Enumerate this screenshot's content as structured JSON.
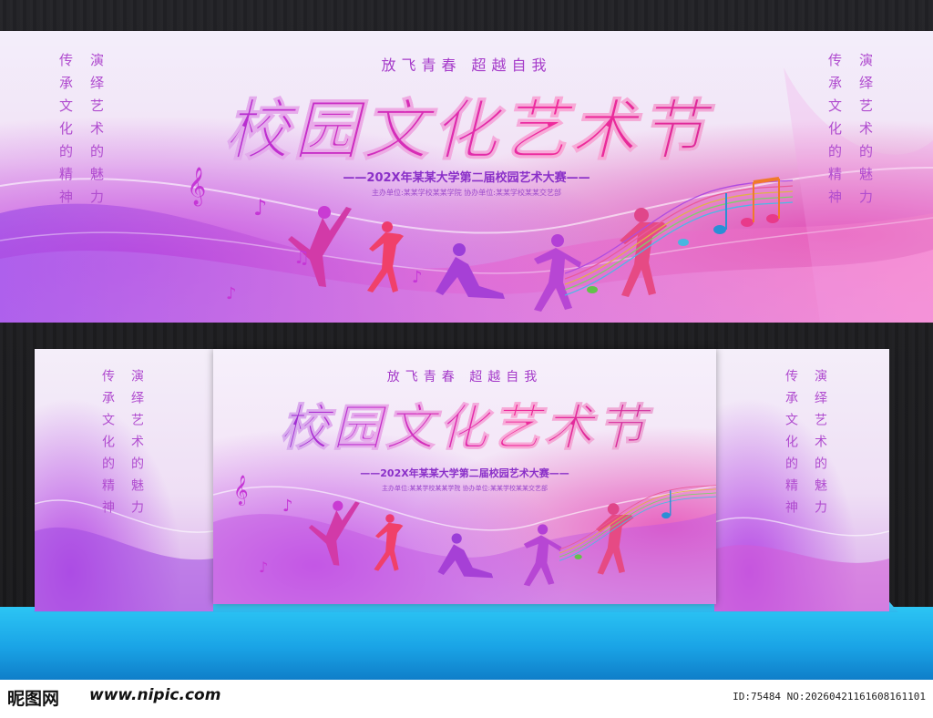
{
  "banner": {
    "slogan": "放飞青春  超越自我",
    "title": "校园文化艺术节",
    "subtitle": "——202X年某某大学第二届校园艺术大赛——",
    "organizer": "主办单位:某某学校某某学院   协办单位:某某学校某某交艺部",
    "left_col_1": "传承文化的精神",
    "left_col_2": "演绎艺术的魅力",
    "right_col_1": "传承文化的精神",
    "right_col_2": "演绎艺术的魅力"
  },
  "footer": {
    "logo": "昵图网",
    "url": "www.nipic.com",
    "id_text": "ID:75484 NO:20260421161608161101"
  },
  "colors": {
    "accent_purple": "#8a2fc8",
    "accent_pink": "#f02a9a",
    "stage_blue": "#1aa4e6"
  }
}
